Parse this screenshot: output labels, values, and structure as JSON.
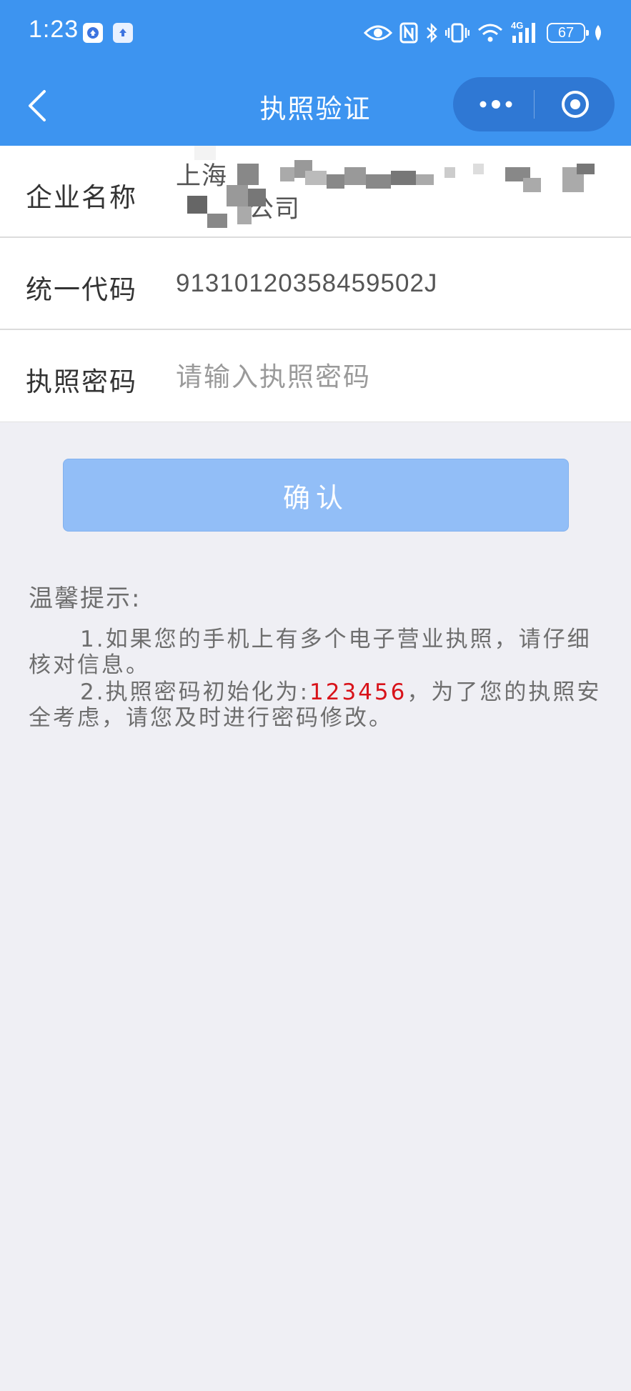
{
  "status_bar": {
    "time": "1:23",
    "network": "4G",
    "battery": "67",
    "icons": [
      "eye-icon",
      "nfc-icon",
      "bluetooth-icon",
      "vibrate-icon",
      "wifi-icon",
      "signal-icon",
      "battery-icon",
      "leaf-icon"
    ]
  },
  "nav": {
    "title": "执照验证",
    "back_icon": "chevron-left-icon",
    "more_icon": "more-dots-icon",
    "close_icon": "target-icon"
  },
  "form": {
    "company_name_label": "企业名称",
    "company_name_value_start": "上海",
    "company_name_value_end": "公司",
    "credit_code_label": "统一代码",
    "credit_code_value": "91310120358459502J",
    "license_password_label": "执照密码",
    "license_password_placeholder": "请输入执照密码",
    "license_password_value": ""
  },
  "confirm_button": "确认",
  "tips": {
    "title": "温馨提示:",
    "item1": "1.如果您的手机上有多个电子营业执照，请仔细核对信息。",
    "item2_prefix": "2.执照密码初始化为:",
    "item2_password": "123456",
    "item2_suffix": "，为了您的执照安全考虑，请您及时进行密码修改。"
  },
  "colors": {
    "header_blue": "#3d94f0",
    "button_blue": "#92bef7",
    "highlight_red": "#d8131a",
    "background": "#efeff4"
  }
}
